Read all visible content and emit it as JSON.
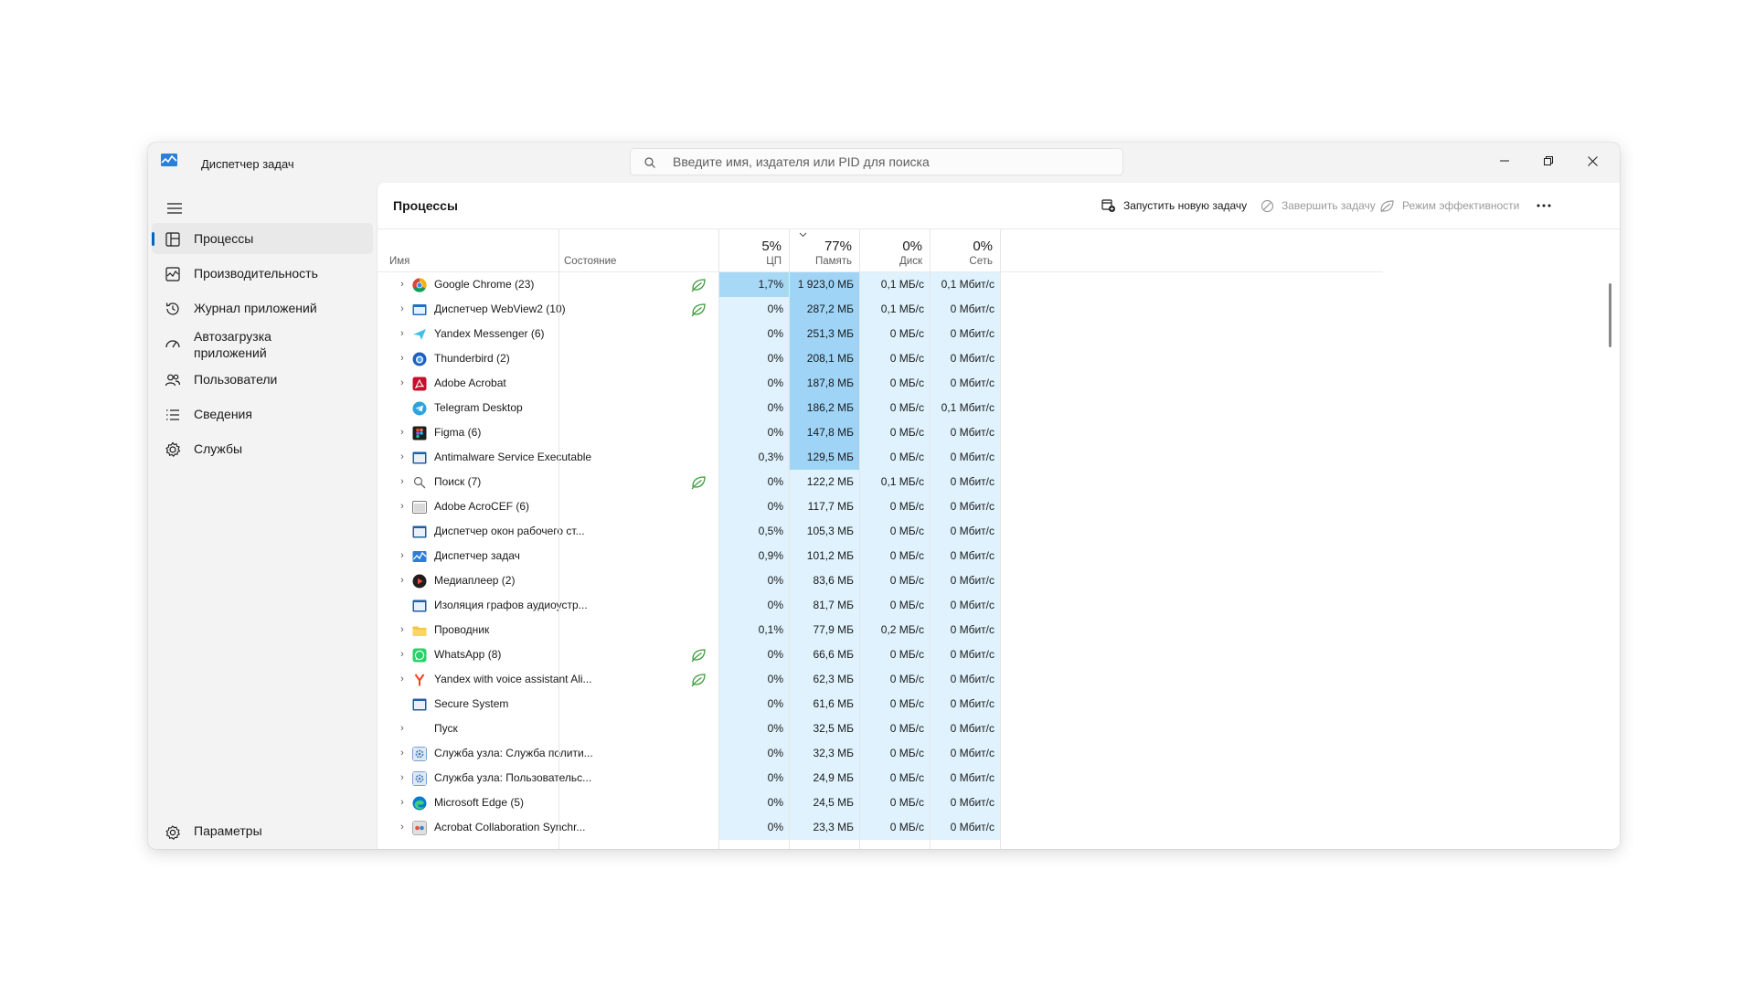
{
  "window": {
    "title": "Диспетчер задач",
    "search_placeholder": "Введите имя, издателя или PID для поиска"
  },
  "sidebar": {
    "items": [
      {
        "label": "Процессы",
        "icon": "processes-icon",
        "active": true
      },
      {
        "label": "Производительность",
        "icon": "performance-icon"
      },
      {
        "label": "Журнал приложений",
        "icon": "app-history-icon"
      },
      {
        "label": "Автозагрузка приложений",
        "icon": "startup-apps-icon"
      },
      {
        "label": "Пользователи",
        "icon": "users-icon"
      },
      {
        "label": "Сведения",
        "icon": "details-icon"
      },
      {
        "label": "Службы",
        "icon": "services-icon"
      }
    ],
    "settings_label": "Параметры"
  },
  "main": {
    "title": "Процессы",
    "toolbar": {
      "run_task": "Запустить новую задачу",
      "end_task": "Завершить задачу",
      "efficiency_mode": "Режим эффективности"
    },
    "columns": {
      "name": "Имя",
      "status": "Состояние",
      "cpu": {
        "label": "ЦП",
        "total": "5%"
      },
      "memory": {
        "label": "Память",
        "total": "77%"
      },
      "disk": {
        "label": "Диск",
        "total": "0%"
      },
      "network": {
        "label": "Сеть",
        "total": "0%"
      }
    },
    "processes": [
      {
        "name": "Google Chrome (23)",
        "icon": "chrome-icon",
        "expandable": true,
        "efficiency": true,
        "cpu": "1,7%",
        "memory": "1 923,0 МБ",
        "disk": "0,1 МБ/с",
        "network": "0,1 Мбит/с"
      },
      {
        "name": "Диспетчер WebView2 (10)",
        "icon": "webview-icon",
        "expandable": true,
        "efficiency": true,
        "cpu": "0%",
        "memory": "287,2 МБ",
        "disk": "0,1 МБ/с",
        "network": "0 Мбит/с"
      },
      {
        "name": "Yandex Messenger (6)",
        "icon": "yandex-messenger-icon",
        "expandable": true,
        "efficiency": false,
        "cpu": "0%",
        "memory": "251,3 МБ",
        "disk": "0 МБ/с",
        "network": "0 Мбит/с"
      },
      {
        "name": "Thunderbird (2)",
        "icon": "thunderbird-icon",
        "expandable": true,
        "efficiency": false,
        "cpu": "0%",
        "memory": "208,1 МБ",
        "disk": "0 МБ/с",
        "network": "0 Мбит/с"
      },
      {
        "name": "Adobe Acrobat",
        "icon": "acrobat-icon",
        "expandable": true,
        "efficiency": false,
        "cpu": "0%",
        "memory": "187,8 МБ",
        "disk": "0 МБ/с",
        "network": "0 Мбит/с"
      },
      {
        "name": "Telegram Desktop",
        "icon": "telegram-icon",
        "expandable": false,
        "efficiency": false,
        "cpu": "0%",
        "memory": "186,2 МБ",
        "disk": "0 МБ/с",
        "network": "0,1 Мбит/с"
      },
      {
        "name": "Figma (6)",
        "icon": "figma-icon",
        "expandable": true,
        "efficiency": false,
        "cpu": "0%",
        "memory": "147,8 МБ",
        "disk": "0 МБ/с",
        "network": "0 Мбит/с"
      },
      {
        "name": "Antimalware Service Executable",
        "icon": "service-window-icon",
        "expandable": true,
        "efficiency": false,
        "cpu": "0,3%",
        "memory": "129,5 МБ",
        "disk": "0 МБ/с",
        "network": "0 Мбит/с"
      },
      {
        "name": "Поиск (7)",
        "icon": "search-app-icon",
        "expandable": true,
        "efficiency": true,
        "cpu": "0%",
        "memory": "122,2 МБ",
        "disk": "0,1 МБ/с",
        "network": "0 Мбит/с"
      },
      {
        "name": "Adobe AcroCEF (6)",
        "icon": "acrocef-icon",
        "expandable": true,
        "efficiency": false,
        "cpu": "0%",
        "memory": "117,7 МБ",
        "disk": "0 МБ/с",
        "network": "0 Мбит/с"
      },
      {
        "name": "Диспетчер окон рабочего ст...",
        "icon": "service-window-icon",
        "expandable": false,
        "efficiency": false,
        "cpu": "0,5%",
        "memory": "105,3 МБ",
        "disk": "0 МБ/с",
        "network": "0 Мбит/с"
      },
      {
        "name": "Диспетчер задач",
        "icon": "task-manager-icon",
        "expandable": true,
        "efficiency": false,
        "cpu": "0,9%",
        "memory": "101,2 МБ",
        "disk": "0 МБ/с",
        "network": "0 Мбит/с"
      },
      {
        "name": "Медиаплеер (2)",
        "icon": "media-player-icon",
        "expandable": true,
        "efficiency": false,
        "cpu": "0%",
        "memory": "83,6 МБ",
        "disk": "0 МБ/с",
        "network": "0 Мбит/с"
      },
      {
        "name": "Изоляция графов аудиоустр...",
        "icon": "service-window-icon",
        "expandable": false,
        "efficiency": false,
        "cpu": "0%",
        "memory": "81,7 МБ",
        "disk": "0 МБ/с",
        "network": "0 Мбит/с"
      },
      {
        "name": "Проводник",
        "icon": "explorer-icon",
        "expandable": true,
        "efficiency": false,
        "cpu": "0,1%",
        "memory": "77,9 МБ",
        "disk": "0,2 МБ/с",
        "network": "0 Мбит/с"
      },
      {
        "name": "WhatsApp (8)",
        "icon": "whatsapp-icon",
        "expandable": true,
        "efficiency": true,
        "cpu": "0%",
        "memory": "66,6 МБ",
        "disk": "0 МБ/с",
        "network": "0 Мбит/с"
      },
      {
        "name": "Yandex with voice assistant Ali...",
        "icon": "yandex-icon",
        "expandable": true,
        "efficiency": true,
        "cpu": "0%",
        "memory": "62,3 МБ",
        "disk": "0 МБ/с",
        "network": "0 Мбит/с"
      },
      {
        "name": "Secure System",
        "icon": "service-window-icon",
        "expandable": false,
        "efficiency": false,
        "cpu": "0%",
        "memory": "61,6 МБ",
        "disk": "0 МБ/с",
        "network": "0 Мбит/с"
      },
      {
        "name": "Пуск",
        "icon": "blank-icon",
        "expandable": true,
        "efficiency": false,
        "cpu": "0%",
        "memory": "32,5 МБ",
        "disk": "0 МБ/с",
        "network": "0 Мбит/с"
      },
      {
        "name": "Служба узла: Служба полити...",
        "icon": "gear-service-icon",
        "expandable": true,
        "efficiency": false,
        "cpu": "0%",
        "memory": "32,3 МБ",
        "disk": "0 МБ/с",
        "network": "0 Мбит/с"
      },
      {
        "name": "Служба узла: Пользовательс...",
        "icon": "gear-service-icon",
        "expandable": true,
        "efficiency": false,
        "cpu": "0%",
        "memory": "24,9 МБ",
        "disk": "0 МБ/с",
        "network": "0 Мбит/с"
      },
      {
        "name": "Microsoft Edge (5)",
        "icon": "edge-icon",
        "expandable": true,
        "efficiency": false,
        "cpu": "0%",
        "memory": "24,5 МБ",
        "disk": "0 МБ/с",
        "network": "0 Мбит/с"
      },
      {
        "name": "Acrobat Collaboration Synchr...",
        "icon": "acrobat-sync-icon",
        "expandable": true,
        "efficiency": false,
        "cpu": "0%",
        "memory": "23,3 МБ",
        "disk": "0 МБ/с",
        "network": "0 Мбит/с"
      }
    ]
  },
  "colors": {
    "accent": "#0067c0",
    "heat_light": "#dff2fd",
    "heat_cpu_high": "#a7d9f7",
    "heat_mem_high": "#9fd4f6",
    "efficiency_leaf": "#3c9a3c"
  }
}
